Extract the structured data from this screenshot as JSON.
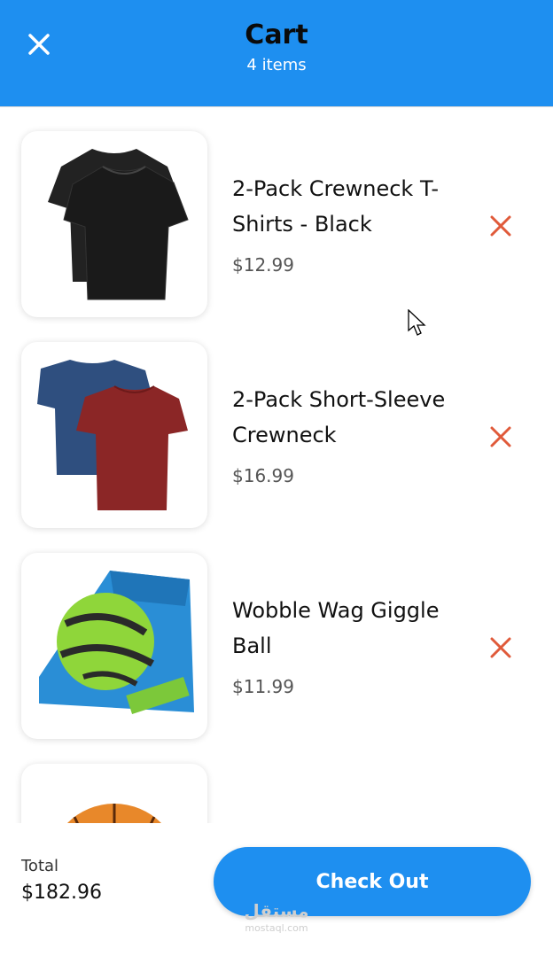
{
  "header": {
    "title": "Cart",
    "subtitle": "4 items",
    "close_icon": "close-icon"
  },
  "items": [
    {
      "name": "2-Pack Crewneck T-Shirts - Black",
      "price": "$12.99",
      "image": "black-tshirts"
    },
    {
      "name": "2-Pack Short-Sleeve Crewneck",
      "price": "$16.99",
      "image": "blue-red-tshirts"
    },
    {
      "name": "Wobble Wag Giggle Ball",
      "price": "$11.99",
      "image": "giggle-ball-box"
    },
    {
      "name": "",
      "price": "",
      "image": "basketball"
    }
  ],
  "footer": {
    "total_label": "Total",
    "total_value": "$182.96",
    "checkout_label": "Check Out"
  },
  "watermark": {
    "arabic": "مستقل",
    "latin": "mostaql.com"
  },
  "colors": {
    "accent": "#1e8ff0",
    "remove": "#e05a3a"
  }
}
